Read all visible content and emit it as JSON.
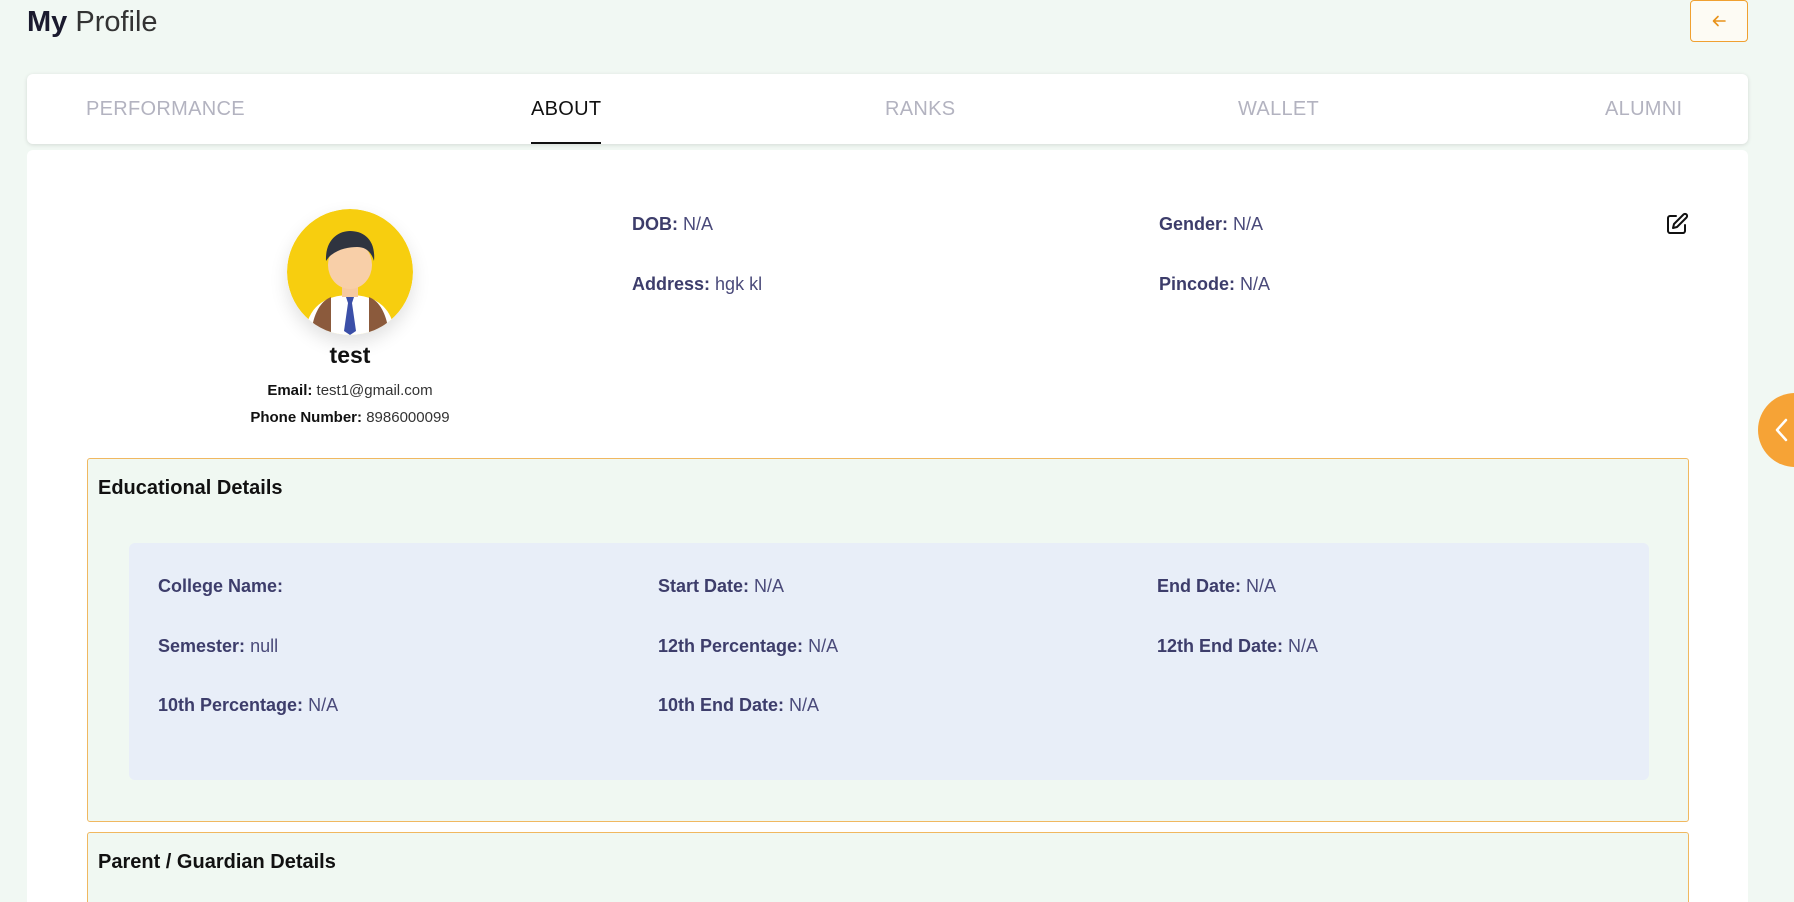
{
  "header": {
    "title_strong": "My",
    "title_light": "Profile",
    "back_icon": "arrow-left-icon"
  },
  "tabs": [
    {
      "label": "PERFORMANCE",
      "active": false
    },
    {
      "label": "ABOUT",
      "active": true
    },
    {
      "label": "RANKS",
      "active": false
    },
    {
      "label": "WALLET",
      "active": false
    },
    {
      "label": "ALUMNI",
      "active": false
    }
  ],
  "profile": {
    "name": "test",
    "email_label": "Email:",
    "email": "test1@gmail.com",
    "phone_label": "Phone Number:",
    "phone": "8986000099"
  },
  "personal": {
    "dob_label": "DOB:",
    "dob": "N/A",
    "gender_label": "Gender:",
    "gender": "N/A",
    "address_label": "Address:",
    "address": "hgk kl",
    "pincode_label": "Pincode:",
    "pincode": "N/A"
  },
  "education": {
    "title": "Educational Details",
    "college_label": "College Name:",
    "college": "",
    "start_label": "Start Date:",
    "start": "N/A",
    "end_label": "End Date:",
    "end": "N/A",
    "semester_label": "Semester:",
    "semester": "null",
    "p12_label": "12th Percentage:",
    "p12": "N/A",
    "e12_label": "12th End Date:",
    "e12": "N/A",
    "p10_label": "10th Percentage:",
    "p10": "N/A",
    "e10_label": "10th End Date:",
    "e10": "N/A"
  },
  "guardian": {
    "title": "Parent / Guardian Details"
  },
  "colors": {
    "accent": "#f6a336",
    "background": "#f1f8f3",
    "label": "#3d3d6b",
    "edu_panel": "#e8eef8"
  }
}
